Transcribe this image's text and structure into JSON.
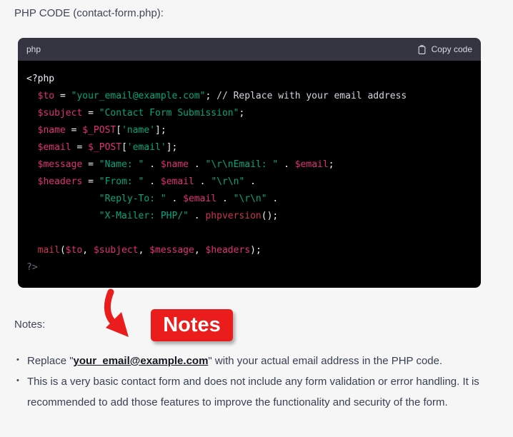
{
  "page": {
    "title": "PHP CODE (contact-form.php):"
  },
  "code_block": {
    "language_label": "php",
    "copy_label": "Copy code",
    "lines": [
      [
        [
          "plain",
          "<?php"
        ]
      ],
      [
        [
          "plain",
          "  "
        ],
        [
          "var",
          "$to"
        ],
        [
          "plain",
          " = "
        ],
        [
          "str",
          "\"your_email@example.com\""
        ],
        [
          "plain",
          "; "
        ],
        [
          "comment",
          "// Replace with your email address"
        ]
      ],
      [
        [
          "plain",
          "  "
        ],
        [
          "var",
          "$subject"
        ],
        [
          "plain",
          " = "
        ],
        [
          "str",
          "\"Contact Form Submission\""
        ],
        [
          "plain",
          ";"
        ]
      ],
      [
        [
          "plain",
          "  "
        ],
        [
          "var",
          "$name"
        ],
        [
          "plain",
          " = "
        ],
        [
          "var",
          "$_POST"
        ],
        [
          "plain",
          "["
        ],
        [
          "str",
          "'name'"
        ],
        [
          "plain",
          "];"
        ]
      ],
      [
        [
          "plain",
          "  "
        ],
        [
          "var",
          "$email"
        ],
        [
          "plain",
          " = "
        ],
        [
          "var",
          "$_POST"
        ],
        [
          "plain",
          "["
        ],
        [
          "str",
          "'email'"
        ],
        [
          "plain",
          "];"
        ]
      ],
      [
        [
          "plain",
          "  "
        ],
        [
          "var",
          "$message"
        ],
        [
          "plain",
          " = "
        ],
        [
          "str",
          "\"Name: \""
        ],
        [
          "plain",
          " . "
        ],
        [
          "var",
          "$name"
        ],
        [
          "plain",
          " . "
        ],
        [
          "str",
          "\"\\r\\nEmail: \""
        ],
        [
          "plain",
          " . "
        ],
        [
          "var",
          "$email"
        ],
        [
          "plain",
          ";"
        ]
      ],
      [
        [
          "plain",
          "  "
        ],
        [
          "var",
          "$headers"
        ],
        [
          "plain",
          " = "
        ],
        [
          "str",
          "\"From: \""
        ],
        [
          "plain",
          " . "
        ],
        [
          "var",
          "$email"
        ],
        [
          "plain",
          " . "
        ],
        [
          "str",
          "\"\\r\\n\""
        ],
        [
          "plain",
          " ."
        ]
      ],
      [
        [
          "plain",
          "             "
        ],
        [
          "str",
          "\"Reply-To: \""
        ],
        [
          "plain",
          " . "
        ],
        [
          "var",
          "$email"
        ],
        [
          "plain",
          " . "
        ],
        [
          "str",
          "\"\\r\\n\""
        ],
        [
          "plain",
          " ."
        ]
      ],
      [
        [
          "plain",
          "             "
        ],
        [
          "str",
          "\"X-Mailer: PHP/\""
        ],
        [
          "plain",
          " . "
        ],
        [
          "fn",
          "phpversion"
        ],
        [
          "plain",
          "();"
        ]
      ],
      [
        [
          "plain",
          ""
        ]
      ],
      [
        [
          "plain",
          "  "
        ],
        [
          "fn",
          "mail"
        ],
        [
          "plain",
          "("
        ],
        [
          "var",
          "$to"
        ],
        [
          "plain",
          ", "
        ],
        [
          "var",
          "$subject"
        ],
        [
          "plain",
          ", "
        ],
        [
          "var",
          "$message"
        ],
        [
          "plain",
          ", "
        ],
        [
          "var",
          "$headers"
        ],
        [
          "plain",
          ");"
        ]
      ],
      [
        [
          "meta",
          "?>"
        ]
      ]
    ]
  },
  "annotation": {
    "callout_text": "Notes",
    "arrow_icon": "red-arrow-down-right",
    "color": "#ea1c1c"
  },
  "notes": {
    "label": "Notes:",
    "bullets": [
      [
        {
          "t": "text",
          "v": "Replace \""
        },
        {
          "t": "link",
          "v": "your_email@example.com"
        },
        {
          "t": "text",
          "v": "\" with your actual email address in the PHP code."
        }
      ],
      [
        {
          "t": "text",
          "v": "This is a very basic contact form and does not include any form validation or error handling. It is recommended to add those features to improve the functionality and security of the form."
        }
      ]
    ]
  },
  "colors": {
    "page_bg": "#f6f6f7",
    "code_header_bg": "#343541",
    "code_bg": "#000000",
    "code_plain": "#eceff4",
    "code_variable": "#df3079",
    "code_string": "#00a67d",
    "code_function": "#c9344f",
    "code_comment": "#d1d5db",
    "code_meta": "#697080",
    "annotation_red": "#ea1c1c"
  }
}
